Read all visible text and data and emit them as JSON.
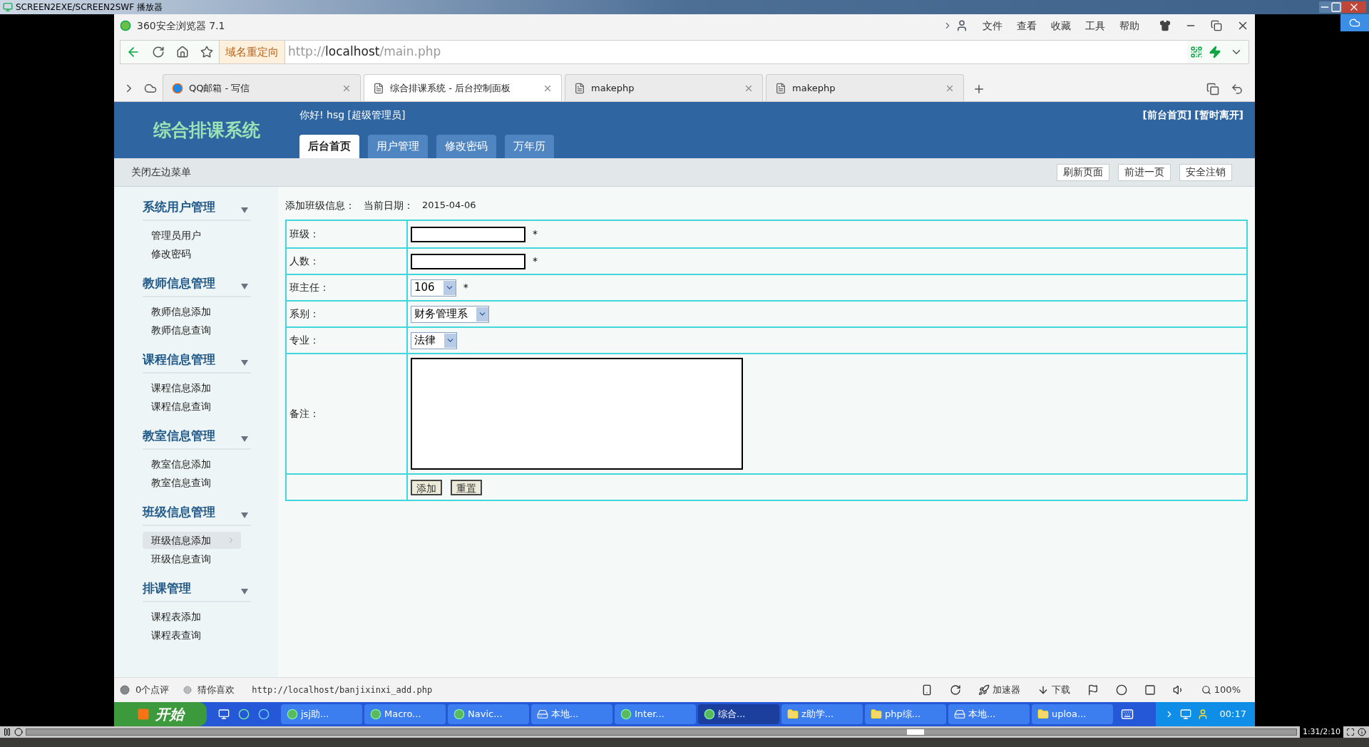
{
  "player": {
    "title": "SCREEN2EXE/SCREEN2SWF 播放器",
    "time": "1:31/2:10",
    "level": 0.7
  },
  "browser": {
    "title": "360安全浏览器 7.1",
    "menu": [
      "文件",
      "查看",
      "收藏",
      "工具",
      "帮助"
    ],
    "redirect": "域名重定向",
    "url": {
      "scheme": "http://",
      "host": "localhost",
      "path": "/main.php"
    },
    "tabs": [
      {
        "label": "QQ邮箱 - 写信",
        "kind": "mail",
        "selected": false
      },
      {
        "label": "综合排课系统 - 后台控制面板",
        "kind": "page",
        "selected": true
      },
      {
        "label": "makephp",
        "kind": "page",
        "selected": false
      },
      {
        "label": "makephp",
        "kind": "page",
        "selected": false
      }
    ]
  },
  "header": {
    "logo": "综合排课系统",
    "greeting": "你好! hsg [超级管理员]",
    "links": [
      "[前台首页]",
      "[暂时离开]"
    ],
    "nav": [
      {
        "label": "后台首页",
        "selected": true
      },
      {
        "label": "用户管理",
        "selected": false
      },
      {
        "label": "修改密码",
        "selected": false
      },
      {
        "label": "万年历",
        "selected": false
      }
    ]
  },
  "toolbar": {
    "toggle": "关闭左边菜单",
    "buttons": [
      "刷新页面",
      "前进一页",
      "安全注销"
    ]
  },
  "sidebar": {
    "groups": [
      {
        "title": "系统用户管理",
        "items": [
          {
            "label": "管理员用户",
            "selected": false
          },
          {
            "label": "修改密码",
            "selected": false
          }
        ]
      },
      {
        "title": "教师信息管理",
        "items": [
          {
            "label": "教师信息添加",
            "selected": false
          },
          {
            "label": "教师信息查询",
            "selected": false
          }
        ]
      },
      {
        "title": "课程信息管理",
        "items": [
          {
            "label": "课程信息添加",
            "selected": false
          },
          {
            "label": "课程信息查询",
            "selected": false
          }
        ]
      },
      {
        "title": "教室信息管理",
        "items": [
          {
            "label": "教室信息添加",
            "selected": false
          },
          {
            "label": "教室信息查询",
            "selected": false
          }
        ]
      },
      {
        "title": "班级信息管理",
        "items": [
          {
            "label": "班级信息添加",
            "selected": true
          },
          {
            "label": "班级信息查询",
            "selected": false
          }
        ]
      },
      {
        "title": "排课管理",
        "items": [
          {
            "label": "课程表添加",
            "selected": false
          },
          {
            "label": "课程表查询",
            "selected": false
          }
        ]
      }
    ]
  },
  "form": {
    "title": "添加班级信息：",
    "date_label": "当前日期：",
    "date": "2015-04-06",
    "rows": [
      {
        "kind": "text",
        "label": "班级：",
        "mark": "*"
      },
      {
        "kind": "text",
        "label": "人数：",
        "mark": "*"
      },
      {
        "kind": "select",
        "label": "班主任：",
        "value": "106",
        "mark": "*"
      },
      {
        "kind": "select",
        "label": "系别：",
        "value": "财务管理系"
      },
      {
        "kind": "select",
        "label": "专业：",
        "value": "法律"
      },
      {
        "kind": "textarea",
        "label": "备注："
      },
      {
        "kind": "buttons",
        "buttons": [
          "添加",
          "重置"
        ]
      }
    ]
  },
  "status_bar": {
    "reviews": "0个点评",
    "guess": "猜你喜欢",
    "url": "http://localhost/banjixinxi_add.php",
    "accelerator": "加速器",
    "download": "下载",
    "zoom": "100%"
  },
  "taskbar": {
    "start": "开始",
    "clock": "00:17",
    "tasks": [
      {
        "label": "jsj助...",
        "kind": "app",
        "selected": false
      },
      {
        "label": "Macro...",
        "kind": "app",
        "selected": false
      },
      {
        "label": "Navic...",
        "kind": "app",
        "selected": false
      },
      {
        "label": "本地...",
        "kind": "drive",
        "selected": false
      },
      {
        "label": "Inter...",
        "kind": "app",
        "selected": false
      },
      {
        "label": "综合...",
        "kind": "app",
        "selected": true
      },
      {
        "label": "z助学...",
        "kind": "folder",
        "selected": false
      },
      {
        "label": "php综...",
        "kind": "folder",
        "selected": false
      },
      {
        "label": "本地...",
        "kind": "drive",
        "selected": false
      },
      {
        "label": "uploa...",
        "kind": "folder",
        "selected": false
      }
    ]
  }
}
